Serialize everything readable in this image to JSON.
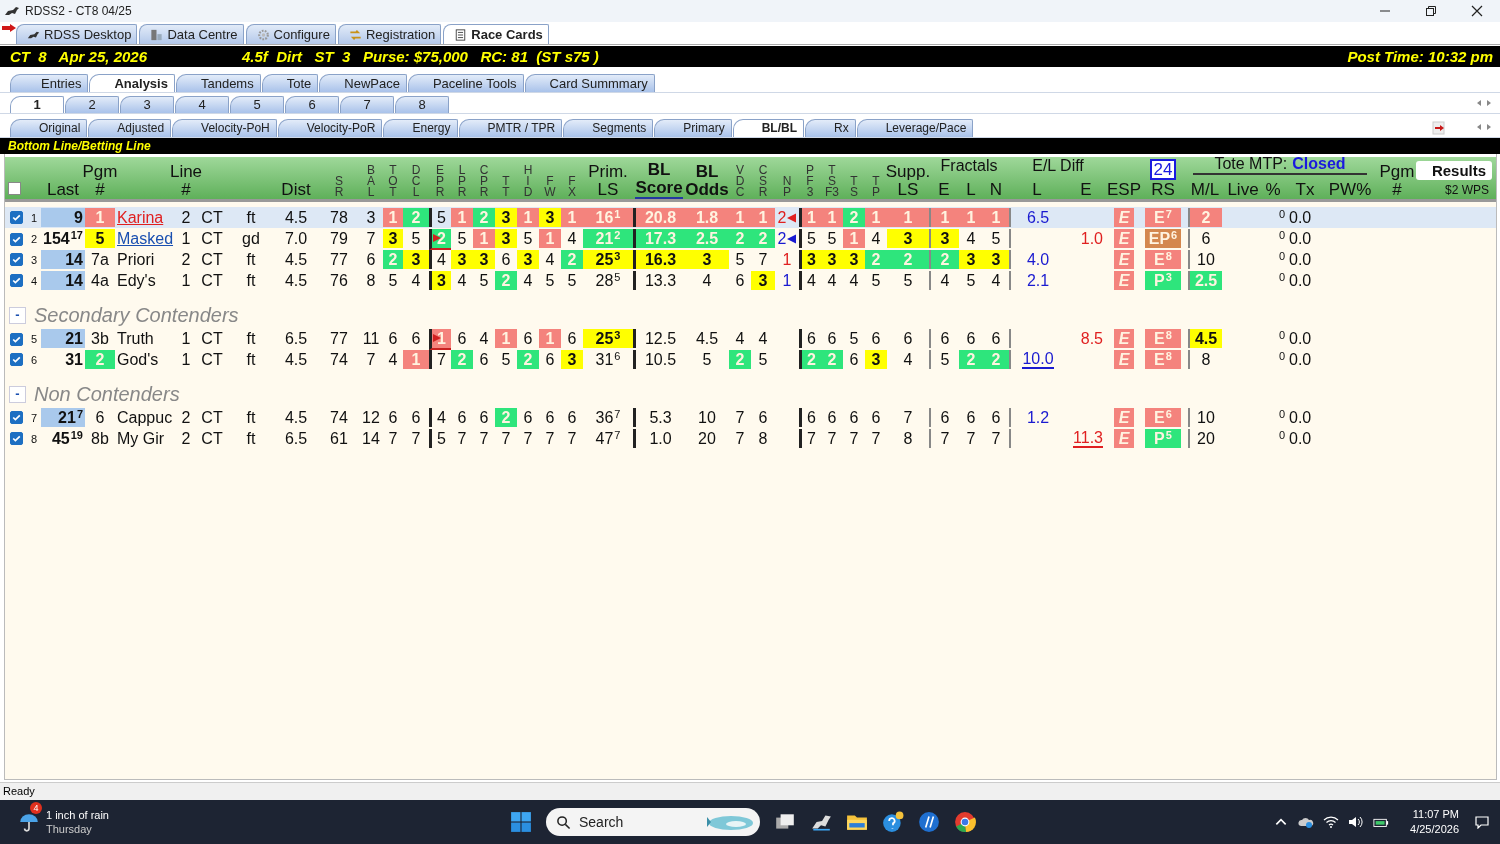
{
  "window": {
    "title": "RDSS2 - CT8  04/25"
  },
  "app_tabs": [
    {
      "label": "RDSS Desktop",
      "selected": false
    },
    {
      "label": "Data Centre",
      "selected": false
    },
    {
      "label": "Configure",
      "selected": false
    },
    {
      "label": "Registration",
      "selected": false
    },
    {
      "label": "Race Cards",
      "selected": true
    }
  ],
  "race_bar": {
    "race": "CT  8   Apr 25, 2026",
    "conditions": "4.5f  Dirt   ST  3   Purse: $75,000   RC: 81  (ST s75 )",
    "post_time": "Post Time: 10:32 pm"
  },
  "view_tabs": [
    {
      "label": "Entries",
      "selected": false
    },
    {
      "label": "Analysis",
      "selected": true
    },
    {
      "label": "Tandems",
      "selected": false
    },
    {
      "label": "Tote",
      "selected": false
    },
    {
      "label": "NewPace",
      "selected": false
    },
    {
      "label": "Paceline Tools",
      "selected": false
    },
    {
      "label": "Card Summmary",
      "selected": false
    }
  ],
  "race_tabs": [
    {
      "label": "1",
      "selected": true
    },
    {
      "label": "2",
      "selected": false
    },
    {
      "label": "3",
      "selected": false
    },
    {
      "label": "4",
      "selected": false
    },
    {
      "label": "5",
      "selected": false
    },
    {
      "label": "6",
      "selected": false
    },
    {
      "label": "7",
      "selected": false
    },
    {
      "label": "8",
      "selected": false
    }
  ],
  "analysis_tabs": [
    {
      "label": "Original",
      "selected": false
    },
    {
      "label": "Adjusted",
      "selected": false
    },
    {
      "label": "Velocity-PoH",
      "selected": false
    },
    {
      "label": "Velocity-PoR",
      "selected": false
    },
    {
      "label": "Energy",
      "selected": false
    },
    {
      "label": "PMTR / TPR",
      "selected": false
    },
    {
      "label": "Segments",
      "selected": false
    },
    {
      "label": "Primary",
      "selected": false
    },
    {
      "label": "BL/BL",
      "selected": true
    },
    {
      "label": "Rx",
      "selected": false
    },
    {
      "label": "Leverage/Pace",
      "selected": false
    }
  ],
  "section_title": "Bottom Line/Betting Line",
  "table": {
    "header_checkbox": {
      "checked": false
    },
    "column_groups": [
      {
        "columns": [
          {
            "heading": [
              "Last"
            ]
          },
          {
            "heading": [
              "Pgm",
              "#"
            ]
          },
          {},
          {
            "heading": [
              "Line",
              "#"
            ]
          },
          {},
          {},
          {
            "heading": [
              "Dist"
            ]
          },
          {
            "heading": [
              "S",
              "R"
            ]
          },
          {
            "heading": [
              "B",
              "A",
              "L"
            ]
          },
          {
            "heading": [
              "T",
              "O",
              "T"
            ]
          },
          {
            "heading": [
              "D",
              "C",
              "L"
            ]
          }
        ]
      },
      {
        "divider": true,
        "heavy": true,
        "columns": [
          {
            "heading": [
              "E",
              "P",
              "R"
            ]
          },
          {
            "heading": [
              "L",
              "P",
              "R"
            ]
          },
          {
            "heading": [
              "C",
              "P",
              "R"
            ]
          },
          {
            "heading": [
              "T",
              "T"
            ]
          },
          {
            "heading": [
              "H",
              "I",
              "D"
            ]
          },
          {
            "heading": [
              "F",
              "W"
            ]
          },
          {
            "heading": [
              "F",
              "X"
            ]
          },
          {
            "heading": [
              "Prim.",
              "LS"
            ]
          }
        ]
      },
      {
        "divider": true,
        "heavy": true,
        "columns": [
          {
            "heading": [
              "BL",
              "Score"
            ],
            "strong": true,
            "sorted": true
          },
          {
            "heading": [
              "BL",
              "Odds"
            ],
            "strong": true
          },
          {
            "heading": [
              "V",
              "D",
              "C"
            ]
          },
          {
            "heading": [
              "C",
              "S",
              "R"
            ]
          },
          {
            "heading": [
              "N",
              "P"
            ]
          }
        ]
      },
      {
        "divider": true,
        "heavy": true,
        "columns": [
          {
            "heading": [
              "P",
              "F",
              "3"
            ]
          },
          {
            "heading": [
              "T",
              "S",
              "F3"
            ]
          },
          {
            "heading": [
              "T",
              "S"
            ]
          },
          {
            "heading": [
              "T",
              "P"
            ]
          },
          {
            "heading": [
              "Supp.",
              "LS"
            ]
          }
        ]
      },
      {
        "divider": true,
        "heavy": false,
        "title": "Fractals",
        "columns": [
          {
            "heading": [
              "E"
            ]
          },
          {
            "heading": [
              "L"
            ]
          },
          {
            "heading": [
              "N"
            ]
          }
        ]
      },
      {
        "divider": true,
        "heavy": false,
        "title": "E/L Diff",
        "columns": [
          {
            "heading": [
              "L"
            ]
          },
          {
            "heading": [
              "E"
            ]
          }
        ]
      },
      {
        "columns": [
          {
            "heading": [
              "ESP"
            ]
          },
          {
            "heading": [
              "RS"
            ],
            "badge": "24"
          }
        ]
      },
      {
        "divider": true,
        "heavy": false,
        "title": "Tote MTP:",
        "status": "Closed",
        "columns": [
          {
            "heading": [
              "M/L"
            ]
          },
          {
            "heading": [
              "Live"
            ]
          },
          {
            "heading": [
              "%"
            ]
          },
          {
            "heading": [
              "Tx"
            ]
          },
          {
            "heading": [
              "PW%"
            ]
          }
        ]
      },
      {
        "columns": [
          {
            "heading": [
              "Pgm",
              "#"
            ]
          },
          {
            "heading": [
              "Results"
            ],
            "kind": "results",
            "note": "$2 WPS"
          }
        ]
      }
    ],
    "row_groups": [
      {
        "rows": [
          {
            "number": "1",
            "checked": true,
            "selected": true,
            "cells": [
              {
                "text": "9",
                "color": "#a9c9ec"
              },
              {
                "text": "1",
                "color": "#f4837d"
              },
              {
                "text": "Karina",
                "kind": "link",
                "color": "#e02020"
              },
              "2",
              "CT",
              "ft",
              "4.5",
              "78",
              "3",
              {
                "text": "1",
                "color": "#f4837d"
              },
              {
                "text": "2",
                "color": "#2ee57c"
              },
              "5",
              {
                "text": "1",
                "color": "#f4837d"
              },
              {
                "text": "2",
                "color": "#2ee57c"
              },
              {
                "text": "3",
                "color": "#ffff00"
              },
              {
                "text": "1",
                "color": "#f4837d"
              },
              {
                "text": "3",
                "color": "#ffff00"
              },
              {
                "text": "1",
                "color": "#f4837d"
              },
              {
                "text": "16",
                "sup": "1",
                "color": "#f4837d"
              },
              {
                "text": "20.8",
                "color": "#f4837d"
              },
              {
                "text": "1.8",
                "color": "#f4837d"
              },
              {
                "text": "1",
                "color": "#f4837d"
              },
              {
                "text": "1",
                "color": "#f4837d"
              },
              {
                "text": "2",
                "kind": "pointer",
                "color": "#e02020"
              },
              {
                "text": "1",
                "color": "#f4837d"
              },
              {
                "text": "1",
                "color": "#f4837d"
              },
              {
                "text": "2",
                "color": "#2ee57c"
              },
              {
                "text": "1",
                "color": "#f4837d"
              },
              {
                "text": "1",
                "color": "#f4837d"
              },
              {
                "text": "1",
                "color": "#f4837d"
              },
              {
                "text": "1",
                "color": "#f4837d"
              },
              {
                "text": "1",
                "color": "#f4837d"
              },
              {
                "text": "6.5",
                "kind": "ink",
                "color": "#1a1ad0"
              },
              null,
              {
                "text": "E",
                "color": "#f4837d"
              },
              {
                "text": "E",
                "sup": "7",
                "color": "#f4837d"
              },
              {
                "text": "2",
                "color": "#f4837d"
              },
              null,
              "0",
              "0.0",
              null
            ]
          },
          {
            "number": "2",
            "checked": true,
            "selected": false,
            "cells": [
              {
                "text": "154",
                "sup": "17"
              },
              {
                "text": "5",
                "color": "#ffff00"
              },
              {
                "text": "Masked",
                "kind": "link",
                "color": "#1a4fb0"
              },
              "1",
              "CT",
              "gd",
              "7.0",
              "79",
              "7",
              {
                "text": "3",
                "color": "#ffff00"
              },
              "5",
              {
                "text": "2",
                "color": "#2ee57c",
                "kind": "flag"
              },
              "5",
              {
                "text": "1",
                "color": "#f4837d"
              },
              {
                "text": "3",
                "color": "#ffff00"
              },
              "5",
              {
                "text": "1",
                "color": "#f4837d"
              },
              "4",
              {
                "text": "21",
                "sup": "2",
                "color": "#2ee57c"
              },
              {
                "text": "17.3",
                "color": "#2ee57c"
              },
              {
                "text": "2.5",
                "color": "#2ee57c"
              },
              {
                "text": "2",
                "color": "#2ee57c"
              },
              {
                "text": "2",
                "color": "#2ee57c"
              },
              {
                "text": "2",
                "kind": "pointer",
                "color": "#1a1ad0"
              },
              "5",
              "5",
              {
                "text": "1",
                "color": "#f4837d"
              },
              "4",
              {
                "text": "3",
                "color": "#ffff00"
              },
              {
                "text": "3",
                "color": "#ffff00"
              },
              "4",
              "5",
              null,
              {
                "text": "1.0",
                "kind": "ink",
                "color": "#e02020"
              },
              {
                "text": "E",
                "color": "#f4837d"
              },
              {
                "text": "EP",
                "sup": "6",
                "color": "#d4874e"
              },
              "6",
              null,
              "0",
              "0.0",
              null
            ]
          },
          {
            "number": "3",
            "checked": true,
            "selected": false,
            "cells": [
              {
                "text": "14",
                "color": "#a9c9ec"
              },
              "7a",
              "Priori",
              "2",
              "CT",
              "ft",
              "4.5",
              "77",
              "6",
              {
                "text": "2",
                "color": "#2ee57c"
              },
              {
                "text": "3",
                "color": "#ffff00"
              },
              "4",
              {
                "text": "3",
                "color": "#ffff00"
              },
              {
                "text": "3",
                "color": "#ffff00"
              },
              "6",
              {
                "text": "3",
                "color": "#ffff00"
              },
              "4",
              {
                "text": "2",
                "color": "#2ee57c"
              },
              {
                "text": "25",
                "sup": "3",
                "color": "#ffff00"
              },
              {
                "text": "16.3",
                "color": "#ffff00"
              },
              {
                "text": "3",
                "color": "#ffff00"
              },
              "5",
              "7",
              {
                "text": "1",
                "kind": "ink",
                "color": "#e02020"
              },
              {
                "text": "3",
                "color": "#ffff00"
              },
              {
                "text": "3",
                "color": "#ffff00"
              },
              {
                "text": "3",
                "color": "#ffff00"
              },
              {
                "text": "2",
                "color": "#2ee57c"
              },
              {
                "text": "2",
                "color": "#2ee57c"
              },
              {
                "text": "2",
                "color": "#2ee57c"
              },
              {
                "text": "3",
                "color": "#ffff00"
              },
              {
                "text": "3",
                "color": "#ffff00"
              },
              {
                "text": "4.0",
                "kind": "ink",
                "color": "#1a1ad0"
              },
              null,
              {
                "text": "E",
                "color": "#f4837d"
              },
              {
                "text": "E",
                "sup": "8",
                "color": "#f4837d"
              },
              "10",
              null,
              "0",
              "0.0",
              null
            ]
          },
          {
            "number": "4",
            "checked": true,
            "selected": false,
            "cells": [
              {
                "text": "14",
                "color": "#a9c9ec"
              },
              "4a",
              "Edy's",
              "1",
              "CT",
              "ft",
              "4.5",
              "76",
              "8",
              "5",
              "4",
              {
                "text": "3",
                "color": "#ffff00"
              },
              "4",
              "5",
              {
                "text": "2",
                "color": "#2ee57c"
              },
              "4",
              "5",
              "5",
              {
                "text": "28",
                "sup": "5"
              },
              "13.3",
              "4",
              "6",
              {
                "text": "3",
                "color": "#ffff00"
              },
              {
                "text": "1",
                "kind": "ink",
                "color": "#1a1ad0"
              },
              "4",
              "4",
              "4",
              "5",
              "5",
              "4",
              "5",
              "4",
              {
                "text": "2.1",
                "kind": "ink",
                "color": "#1a1ad0"
              },
              null,
              {
                "text": "E",
                "color": "#f4837d"
              },
              {
                "text": "P",
                "sup": "3",
                "color": "#2ee57c"
              },
              {
                "text": "2.5",
                "color": "#2ee57c"
              },
              null,
              "0",
              "0.0",
              null
            ]
          }
        ]
      },
      {
        "title": "Secondary Contenders",
        "toggle": "-",
        "rows": [
          {
            "number": "5",
            "checked": true,
            "selected": false,
            "cells": [
              {
                "text": "21",
                "color": "#a9c9ec"
              },
              "3b",
              "Truth",
              "1",
              "CT",
              "ft",
              "6.5",
              "77",
              "11",
              "6",
              "6",
              {
                "text": "1",
                "color": "#f4837d",
                "kind": "flag"
              },
              "6",
              "4",
              {
                "text": "1",
                "color": "#f4837d"
              },
              "6",
              {
                "text": "1",
                "color": "#f4837d"
              },
              "6",
              {
                "text": "25",
                "sup": "3",
                "color": "#ffff00"
              },
              "12.5",
              "4.5",
              "4",
              "4",
              null,
              "6",
              "6",
              "5",
              "6",
              "6",
              "6",
              "6",
              "6",
              null,
              {
                "text": "8.5",
                "kind": "ink",
                "color": "#e02020"
              },
              {
                "text": "E",
                "color": "#f4837d"
              },
              {
                "text": "E",
                "sup": "8",
                "color": "#f4837d"
              },
              {
                "text": "4.5",
                "color": "#ffff00"
              },
              null,
              "0",
              "0.0",
              null
            ]
          },
          {
            "number": "6",
            "checked": true,
            "selected": false,
            "cells": [
              "31",
              {
                "text": "2",
                "color": "#2ee57c"
              },
              "God's",
              "1",
              "CT",
              "ft",
              "4.5",
              "74",
              "7",
              "4",
              {
                "text": "1",
                "color": "#f4837d"
              },
              "7",
              {
                "text": "2",
                "color": "#2ee57c"
              },
              "6",
              "5",
              {
                "text": "2",
                "color": "#2ee57c"
              },
              "6",
              {
                "text": "3",
                "color": "#ffff00"
              },
              {
                "text": "31",
                "sup": "6"
              },
              "10.5",
              "5",
              {
                "text": "2",
                "color": "#2ee57c"
              },
              "5",
              null,
              {
                "text": "2",
                "color": "#2ee57c"
              },
              {
                "text": "2",
                "color": "#2ee57c"
              },
              "6",
              {
                "text": "3",
                "color": "#ffff00"
              },
              "4",
              "5",
              {
                "text": "2",
                "color": "#2ee57c"
              },
              {
                "text": "2",
                "color": "#2ee57c"
              },
              {
                "text": "10.0",
                "kind": "ink",
                "color": "#1a1ad0",
                "underline": true
              },
              null,
              {
                "text": "E",
                "color": "#f4837d"
              },
              {
                "text": "E",
                "sup": "8",
                "color": "#f4837d"
              },
              "8",
              null,
              "0",
              "0.0",
              null
            ]
          }
        ]
      },
      {
        "title": "Non Contenders",
        "toggle": "-",
        "rows": [
          {
            "number": "7",
            "checked": true,
            "selected": false,
            "cells": [
              {
                "text": "21",
                "sup": "7",
                "color": "#a9c9ec"
              },
              "6",
              "Cappuc",
              "2",
              "CT",
              "ft",
              "4.5",
              "74",
              "12",
              "6",
              "6",
              "4",
              "6",
              "6",
              {
                "text": "2",
                "color": "#2ee57c"
              },
              "6",
              "6",
              "6",
              {
                "text": "36",
                "sup": "7"
              },
              "5.3",
              "10",
              "7",
              "6",
              null,
              "6",
              "6",
              "6",
              "6",
              "7",
              "6",
              "6",
              "6",
              {
                "text": "1.2",
                "kind": "ink",
                "color": "#1a1ad0"
              },
              null,
              {
                "text": "E",
                "color": "#f4837d"
              },
              {
                "text": "E",
                "sup": "6",
                "color": "#f4837d"
              },
              "10",
              null,
              "0",
              "0.0",
              null
            ]
          },
          {
            "number": "8",
            "checked": true,
            "selected": false,
            "cells": [
              {
                "text": "45",
                "sup": "19"
              },
              "8b",
              "My Gir",
              "2",
              "CT",
              "ft",
              "6.5",
              "61",
              "14",
              "7",
              "7",
              "5",
              "7",
              "7",
              "7",
              "7",
              "7",
              "7",
              {
                "text": "47",
                "sup": "7"
              },
              "1.0",
              "20",
              "7",
              "8",
              null,
              "7",
              "7",
              "7",
              "7",
              "8",
              "7",
              "7",
              "7",
              null,
              {
                "text": "11.3",
                "kind": "ink",
                "color": "#e02020",
                "underline": true
              },
              {
                "text": "E",
                "color": "#f4837d"
              },
              {
                "text": "P",
                "sup": "5",
                "color": "#2ee57c"
              },
              "20",
              null,
              "0",
              "0.0",
              null
            ]
          }
        ]
      }
    ]
  },
  "status_bar": "Ready",
  "taskbar": {
    "weather": "1 inch of rain",
    "day": "Thursday",
    "badge": "4",
    "search": "Search",
    "time": "11:07 PM",
    "date": "4/25/2026"
  }
}
